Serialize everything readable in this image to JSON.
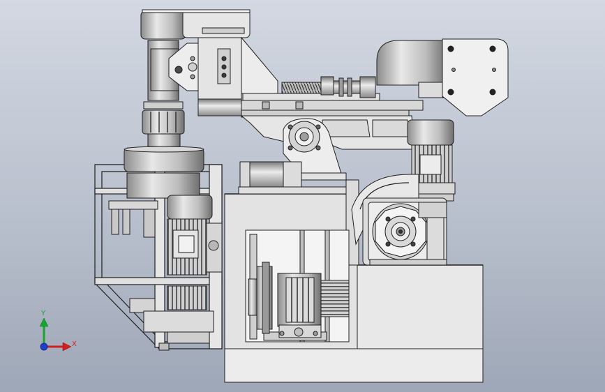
{
  "viewport": {
    "background_top": "#d3d8e2",
    "background_bottom": "#9ea7b7"
  },
  "model": {
    "edge_color": "#1f1f1f",
    "face_light": "#f2f2f2",
    "face_mid": "#d9d9d9",
    "face_dark": "#a7a7a7"
  },
  "triad": {
    "x_label": "X",
    "y_label": "Y",
    "x_color": "#d11f1f",
    "y_color": "#18a52f",
    "z_color": "#1f3fd1"
  }
}
